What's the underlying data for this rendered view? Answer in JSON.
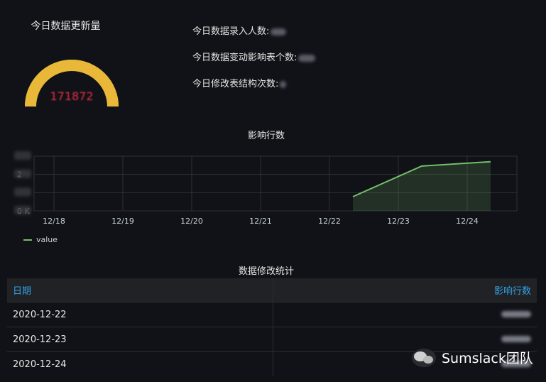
{
  "gauge": {
    "title": "今日数据更新量",
    "value_text": "171872",
    "value_fraction": 1.0,
    "colors": {
      "arc": "#eab839",
      "outline": "#73bf69",
      "value": "#e02f44"
    }
  },
  "stats": [
    {
      "label": "今日数据录入人数:"
    },
    {
      "label": "今日数据变动影响表个数:"
    },
    {
      "label": "今日修改表结构次数:"
    }
  ],
  "chart_panel": {
    "title": "影响行数",
    "legend_label": "value"
  },
  "chart_data": {
    "type": "area",
    "title": "影响行数",
    "x_tick_labels": [
      "12/18",
      "12/19",
      "12/20",
      "12/21",
      "12/22",
      "12/23",
      "12/24"
    ],
    "series": [
      {
        "name": "value",
        "color": "#73bf69",
        "points": [
          [
            "12/22",
            0.26
          ],
          [
            "12/23",
            0.82
          ],
          [
            "12/24",
            0.9
          ]
        ]
      }
    ],
    "y_tick_labels": [
      "",
      "2",
      "",
      "0 K"
    ],
    "grid": true,
    "legend": "bottom-left"
  },
  "table": {
    "title": "数据修改统计",
    "columns": [
      "日期",
      "影响行数"
    ],
    "rows": [
      {
        "date": "2020-12-22"
      },
      {
        "date": "2020-12-23"
      },
      {
        "date": "2020-12-24"
      }
    ],
    "header_color": "#33a2e5"
  },
  "watermark": {
    "text": "Sumslack团队"
  }
}
